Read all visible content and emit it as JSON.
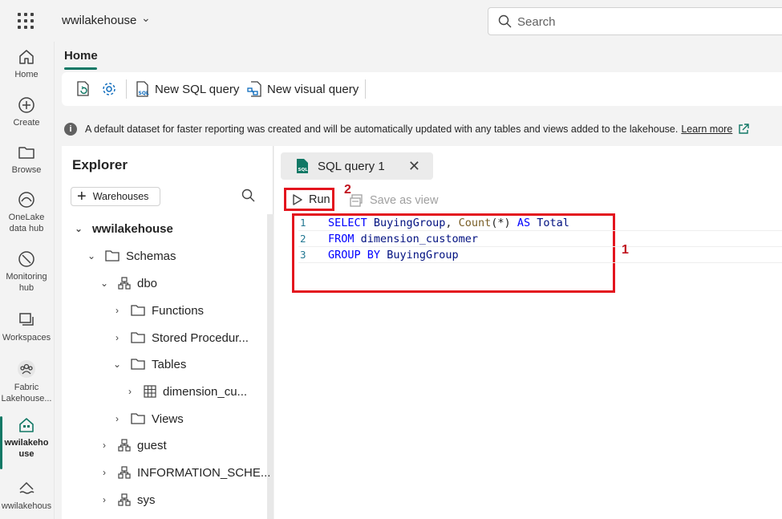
{
  "topbar": {
    "workspace_title": "wwilakehouse",
    "search_placeholder": "Search"
  },
  "rail": [
    {
      "label": "Home",
      "icon": "home-icon"
    },
    {
      "label": "Create",
      "icon": "create-icon"
    },
    {
      "label": "Browse",
      "icon": "browse-icon"
    },
    {
      "label": "OneLake data hub",
      "icon": "onelake-icon"
    },
    {
      "label": "Monitoring hub",
      "icon": "monitoring-icon"
    },
    {
      "label": "Workspaces",
      "icon": "workspaces-icon"
    },
    {
      "label": "Fabric Lakehouse...",
      "icon": "fabric-lakehouse-icon"
    },
    {
      "label": "wwilakehouse",
      "icon": "lakehouse-icon"
    },
    {
      "label": "wwilakehous",
      "icon": "lakehouse-water-icon"
    }
  ],
  "ribbon": {
    "tab_home": "Home",
    "new_sql_query": "New SQL query",
    "new_visual_query": "New visual query"
  },
  "info": {
    "message": "A default dataset for faster reporting was created and will be automatically updated with any tables and views added to the lakehouse.",
    "learn_more": "Learn more"
  },
  "explorer": {
    "title": "Explorer",
    "warehouses_button": "Warehouses",
    "tree": {
      "root": "wwilakehouse",
      "schemas": "Schemas",
      "dbo": "dbo",
      "functions": "Functions",
      "stored_procedures": "Stored Procedur...",
      "tables": "Tables",
      "dimension_customer": "dimension_cu...",
      "views": "Views",
      "guest": "guest",
      "information_schema": "INFORMATION_SCHE...",
      "sys": "sys"
    }
  },
  "editor": {
    "tab_label": "SQL query 1",
    "run_label": "Run",
    "save_as_view": "Save as view",
    "callout_1": "1",
    "callout_2": "2",
    "lines": [
      {
        "num": "1",
        "text": "SELECT BuyingGroup, Count(*) AS Total"
      },
      {
        "num": "2",
        "text": "FROM dimension_customer"
      },
      {
        "num": "3",
        "text": "GROUP BY BuyingGroup"
      }
    ]
  },
  "colors": {
    "accent": "#117865",
    "highlight_red": "#e3141e",
    "sql_keyword": "#0000ff"
  }
}
